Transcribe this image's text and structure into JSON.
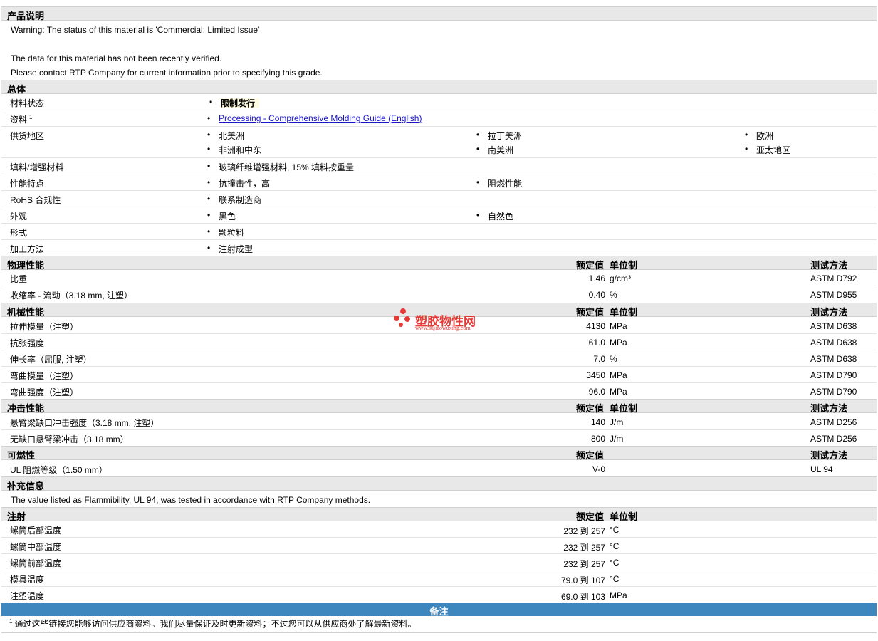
{
  "sections": {
    "desc": "产品说明",
    "general": "总体",
    "physical": "物理性能",
    "mechanical": "机械性能",
    "impact": "冲击性能",
    "flammability": "可燃性",
    "additional": "补充信息",
    "injection": "注射",
    "notes": "备注"
  },
  "headers": {
    "nominal": "额定值",
    "unit": "单位制",
    "method": "测试方法"
  },
  "desc": {
    "warning": "Warning: The status of this material is 'Commercial: Limited Issue'",
    "line1": "The data for this material has not been recently verified.",
    "line2": "Please contact RTP Company for current information prior to specifying this grade."
  },
  "general": {
    "status_label": "材料状态",
    "status_value": "限制发行",
    "docs_label": "资料",
    "docs_sup": "1",
    "docs_link": "Processing - Comprehensive Molding Guide (English)",
    "supply_label": "供货地区",
    "supply": [
      "北美洲",
      "拉丁美洲",
      "欧洲",
      "非洲和中东",
      "南美洲",
      "亚太地区"
    ],
    "filler_label": "填料/增强材料",
    "filler_value": "玻璃纤维增强材料, 15% 填料按重量",
    "features_label": "性能特点",
    "features": [
      "抗撞击性，高",
      "阻燃性能"
    ],
    "rohs_label": "RoHS 合规性",
    "rohs_value": "联系制造商",
    "appearance_label": "外观",
    "appearance": [
      "黑色",
      "自然色"
    ],
    "form_label": "形式",
    "form_value": "颗粒料",
    "process_label": "加工方法",
    "process_value": "注射成型"
  },
  "physical": [
    {
      "label": "比重",
      "value": "1.46",
      "unit": "g/cm³",
      "method": "ASTM D792"
    },
    {
      "label": "收缩率  - 流动（3.18 mm, 注塑）",
      "value": "0.40",
      "unit": "%",
      "method": "ASTM D955"
    }
  ],
  "mechanical": [
    {
      "label": "拉伸模量（注塑）",
      "value": "4130",
      "unit": "MPa",
      "method": "ASTM D638"
    },
    {
      "label": "抗张强度",
      "value": "61.0",
      "unit": "MPa",
      "method": "ASTM D638"
    },
    {
      "label": "伸长率（屈服, 注塑）",
      "value": "7.0",
      "unit": "%",
      "method": "ASTM D638"
    },
    {
      "label": "弯曲模量（注塑）",
      "value": "3450",
      "unit": "MPa",
      "method": "ASTM D790"
    },
    {
      "label": "弯曲强度（注塑）",
      "value": "96.0",
      "unit": "MPa",
      "method": "ASTM D790"
    }
  ],
  "impact": [
    {
      "label": "悬臂梁缺口冲击强度（3.18 mm, 注塑）",
      "value": "140",
      "unit": "J/m",
      "method": "ASTM D256"
    },
    {
      "label": "无缺口悬臂梁冲击（3.18 mm）",
      "value": "800",
      "unit": "J/m",
      "method": "ASTM D256"
    }
  ],
  "flammability": [
    {
      "label": "UL 阻燃等级（1.50 mm）",
      "value": "V-0",
      "unit": "",
      "method": "UL 94"
    }
  ],
  "additional": {
    "text": "The value listed as Flammibility, UL 94, was tested in accordance with RTP Company methods."
  },
  "injection": [
    {
      "label": "螺筒后部温度",
      "value": "232 到  257",
      "unit": "°C"
    },
    {
      "label": "螺筒中部温度",
      "value": "232 到  257",
      "unit": "°C"
    },
    {
      "label": "螺筒前部温度",
      "value": "232 到  257",
      "unit": "°C"
    },
    {
      "label": "模具温度",
      "value": "79.0 到  107",
      "unit": "°C"
    },
    {
      "label": "注塑温度",
      "value": "69.0 到  103",
      "unit": "MPa"
    }
  ],
  "notes": {
    "sup": "1",
    "text": "通过这些链接您能够访问供应商资料。我们尽量保证及时更新资料；不过您可以从供应商处了解最新资料。"
  },
  "watermark": {
    "brand": "塑胶物性网",
    "url": "www.sujiaowuxing.com"
  }
}
